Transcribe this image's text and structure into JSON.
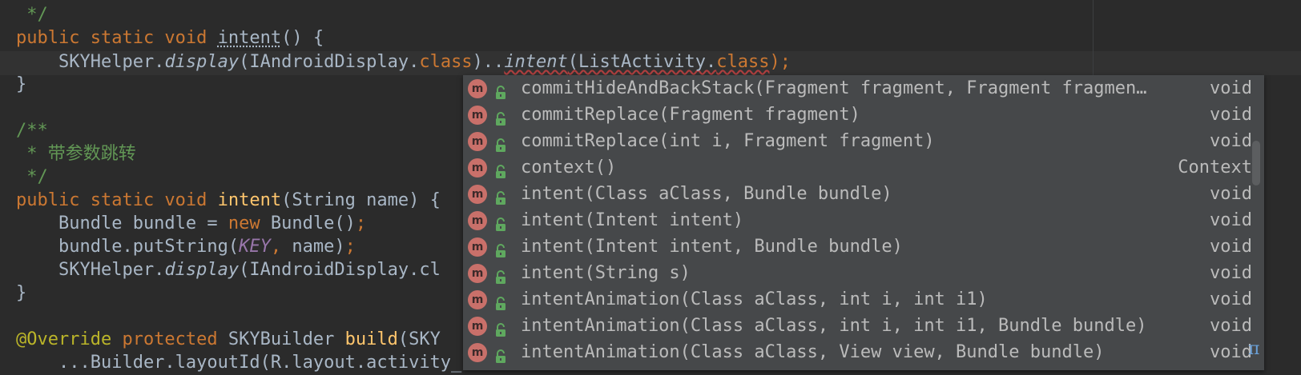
{
  "code_lines": [
    {
      "id": "l0",
      "parts": [
        {
          "t": " */",
          "c": "cm"
        }
      ]
    },
    {
      "id": "l1",
      "parts": [
        {
          "t": "public static void ",
          "c": "kw"
        },
        {
          "t": "intent",
          "c": "dotted"
        },
        {
          "t": "() {",
          "c": ""
        }
      ]
    },
    {
      "id": "l2",
      "parts": [
        {
          "t": "    SKYHelper.",
          "c": ""
        },
        {
          "t": "display",
          "c": "it"
        },
        {
          "t": "(IAndroidDisplay.",
          "c": ""
        },
        {
          "t": "class",
          "c": "kw"
        },
        {
          "t": ")..",
          "c": ""
        },
        {
          "t": "intent",
          "c": "it squiggle"
        },
        {
          "t": "(ListActivity.",
          "c": "squiggle"
        },
        {
          "t": "class",
          "c": "kw squiggle"
        },
        {
          "t": ");",
          "c": "kw"
        }
      ]
    },
    {
      "id": "l3",
      "parts": [
        {
          "t": "}",
          "c": ""
        }
      ]
    },
    {
      "id": "l4",
      "parts": [
        {
          "t": "",
          "c": ""
        }
      ]
    },
    {
      "id": "l5",
      "parts": [
        {
          "t": "/**",
          "c": "cm"
        }
      ]
    },
    {
      "id": "l6",
      "parts": [
        {
          "t": " * 带参数跳转",
          "c": "cm"
        }
      ]
    },
    {
      "id": "l7",
      "parts": [
        {
          "t": " */",
          "c": "cm"
        }
      ]
    },
    {
      "id": "l8",
      "parts": [
        {
          "t": "public static void ",
          "c": "kw"
        },
        {
          "t": "intent",
          "c": "fn-decl"
        },
        {
          "t": "(String name) {",
          "c": ""
        }
      ]
    },
    {
      "id": "l9",
      "parts": [
        {
          "t": "    Bundle bundle = ",
          "c": ""
        },
        {
          "t": "new ",
          "c": "kw"
        },
        {
          "t": "Bundle()",
          "c": ""
        },
        {
          "t": ";",
          "c": "kw"
        }
      ]
    },
    {
      "id": "l10",
      "parts": [
        {
          "t": "    bundle.putString(",
          "c": ""
        },
        {
          "t": "KEY",
          "c": "const"
        },
        {
          "t": ", ",
          "c": "kw"
        },
        {
          "t": "name)",
          "c": ""
        },
        {
          "t": ";",
          "c": "kw"
        }
      ]
    },
    {
      "id": "l11",
      "parts": [
        {
          "t": "    SKYHelper.",
          "c": ""
        },
        {
          "t": "display",
          "c": "it"
        },
        {
          "t": "(IAndroidDisplay.cl",
          "c": ""
        }
      ]
    },
    {
      "id": "l12",
      "parts": [
        {
          "t": "}",
          "c": ""
        }
      ]
    },
    {
      "id": "l13",
      "parts": [
        {
          "t": "",
          "c": ""
        }
      ]
    },
    {
      "id": "l14",
      "parts": [
        {
          "t": "@Override ",
          "c": "ann"
        },
        {
          "t": "protected ",
          "c": "kw"
        },
        {
          "t": "SKYBuilder ",
          "c": ""
        },
        {
          "t": "build",
          "c": "fn-decl"
        },
        {
          "t": "(SKY",
          "c": ""
        }
      ]
    },
    {
      "id": "l15",
      "parts": [
        {
          "t": "    ...Builder.layoutId(R.layout.activity_list)",
          "c": ""
        }
      ]
    }
  ],
  "completion": {
    "icon_letter": "m",
    "items": [
      {
        "signature": "commitHideAndBackStack(Fragment fragment, Fragment fragmen…",
        "return_type": "void"
      },
      {
        "signature": "commitReplace(Fragment fragment)",
        "return_type": "void"
      },
      {
        "signature": "commitReplace(int i, Fragment fragment)",
        "return_type": "void"
      },
      {
        "signature": "context()",
        "return_type": "Context"
      },
      {
        "signature": "intent(Class aClass, Bundle bundle)",
        "return_type": "void"
      },
      {
        "signature": "intent(Intent intent)",
        "return_type": "void"
      },
      {
        "signature": "intent(Intent intent, Bundle bundle)",
        "return_type": "void"
      },
      {
        "signature": "intent(String s)",
        "return_type": "void"
      },
      {
        "signature": "intentAnimation(Class aClass, int i, int i1)",
        "return_type": "void"
      },
      {
        "signature": "intentAnimation(Class aClass, int i, int i1, Bundle bundle)",
        "return_type": "void"
      },
      {
        "signature": "intentAnimation(Class aClass, View view, Bundle bundle)",
        "return_type": "void"
      }
    ],
    "footer_symbol": "π"
  },
  "colors": {
    "background": "#2b2b2b",
    "keyword": "#cc7832",
    "comment": "#629755",
    "method_icon": "#c9706a",
    "lock_icon": "#5fa85f"
  }
}
